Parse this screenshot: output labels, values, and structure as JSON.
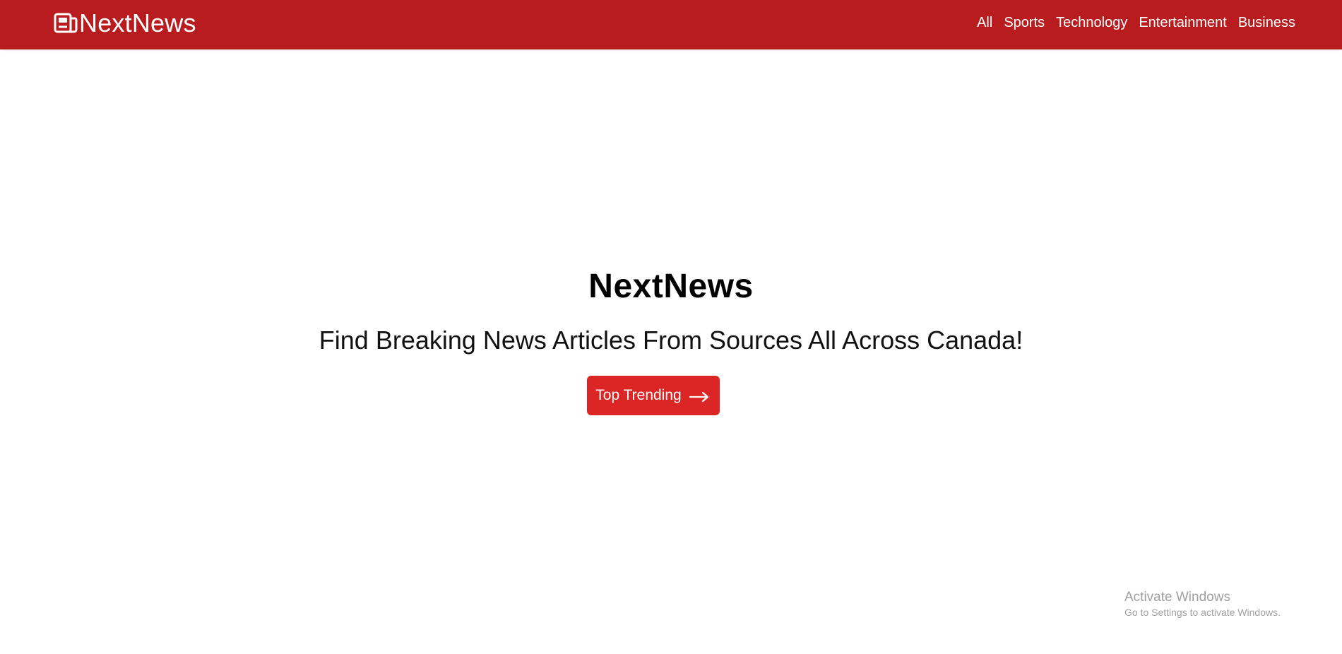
{
  "navbar": {
    "brand": {
      "name": "NextNews",
      "icon": "newspaper-icon"
    },
    "links": [
      "All",
      "Sports",
      "Technology",
      "Entertainment",
      "Business"
    ],
    "background_color": "#b81c1e"
  },
  "hero": {
    "title": "NextNews",
    "subtitle": "Find Breaking News Articles From Sources All Across Canada!",
    "cta": {
      "label": "Top Trending",
      "icon": "arrow-right-icon",
      "color": "#dc2626"
    }
  },
  "system_overlay": {
    "watermark_title": "Activate Windows",
    "watermark_subtitle": "Go to Settings to activate Windows."
  }
}
